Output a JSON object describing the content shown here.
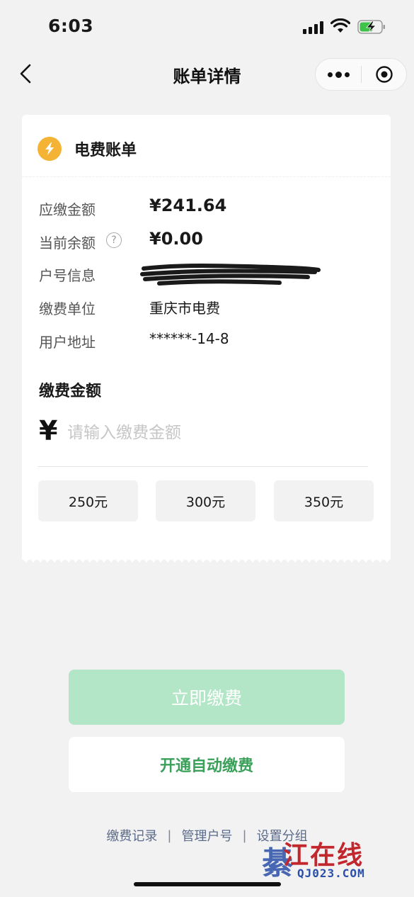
{
  "status_bar": {
    "time": "6:03"
  },
  "nav": {
    "title": "账单详情"
  },
  "bill": {
    "title": "电费账单",
    "rows": [
      {
        "label": "应缴金额",
        "value": "¥241.64"
      },
      {
        "label": "当前余额",
        "value": "¥0.00",
        "help_icon": "question-circle-icon"
      },
      {
        "label": "户号信息",
        "value": ""
      },
      {
        "label": "缴费单位",
        "value": "重庆市电费"
      },
      {
        "label": "用户地址",
        "value": "******-14-8"
      }
    ]
  },
  "payment": {
    "title": "缴费金额",
    "currency_symbol": "¥",
    "amount_placeholder": "请输入缴费金额",
    "amount_value": "",
    "quick_amounts": [
      "250元",
      "300元",
      "350元"
    ]
  },
  "actions": {
    "pay_now": "立即缴费",
    "auto_pay": "开通自动缴费",
    "pay_now_color": "#b2e6c6",
    "auto_pay_color": "#3aa05a"
  },
  "footer": {
    "links": [
      "缴费记录",
      "管理户号",
      "设置分组"
    ],
    "separator": "|"
  },
  "watermark": {
    "text": "江在线",
    "domain": "QJ023.COM",
    "mark": "綦"
  },
  "colors": {
    "bolt": "#f5b335",
    "background": "#f2f2f2",
    "link": "#5c6b8a"
  }
}
